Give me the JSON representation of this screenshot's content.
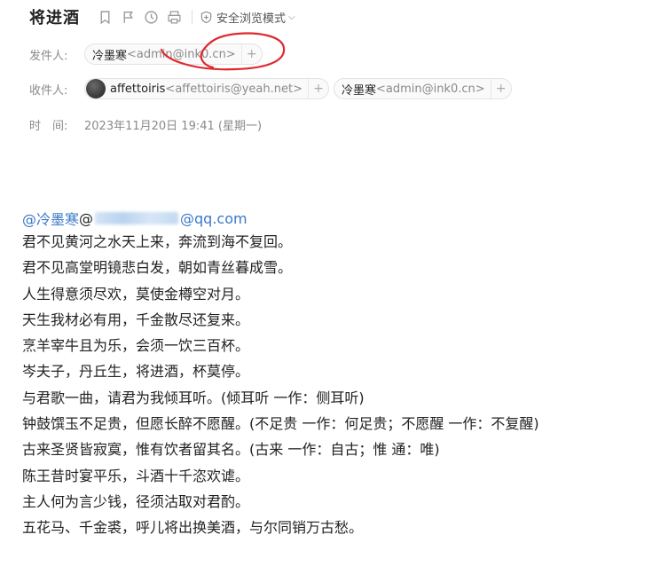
{
  "subject": "将进酒",
  "toolbar": {
    "icons": [
      "bookmark-icon",
      "flag-icon",
      "clock-icon",
      "print-icon"
    ],
    "safe_mode_label": "安全浏览模式"
  },
  "sender": {
    "label": "发件人:",
    "name": "冷墨寒",
    "address": "<admin@ink0.cn>"
  },
  "recipients": {
    "label": "收件人:",
    "items": [
      {
        "name": "affettoiris",
        "address": "<affettoiris@yeah.net>"
      },
      {
        "name": "冷墨寒",
        "address": "<admin@ink0.cn>"
      }
    ]
  },
  "time": {
    "label": "时　间:",
    "value": "2023年11月20日 19:41 (星期一)"
  },
  "body": {
    "mention_name": "@冷墨寒",
    "mention_at": " @",
    "mention_domain": "@qq.com",
    "lines": [
      "君不见黄河之水天上来，奔流到海不复回。",
      "君不见高堂明镜悲白发，朝如青丝暮成雪。",
      "人生得意须尽欢，莫使金樽空对月。",
      "天生我材必有用，千金散尽还复来。",
      "烹羊宰牛且为乐，会须一饮三百杯。",
      "岑夫子，丹丘生，将进酒，杯莫停。",
      "与君歌一曲，请君为我倾耳听。(倾耳听 一作：侧耳听)",
      "钟鼓馔玉不足贵，但愿长醉不愿醒。(不足贵 一作：何足贵；不愿醒 一作：不复醒)",
      "古来圣贤皆寂寞，惟有饮者留其名。(古来 一作：自古；惟 通：唯)",
      "陈王昔时宴平乐，斗酒十千恣欢谑。",
      "主人何为言少钱，径须沽取对君酌。",
      "五花马、千金裘，呼儿将出换美酒，与尔同销万古愁。"
    ]
  }
}
